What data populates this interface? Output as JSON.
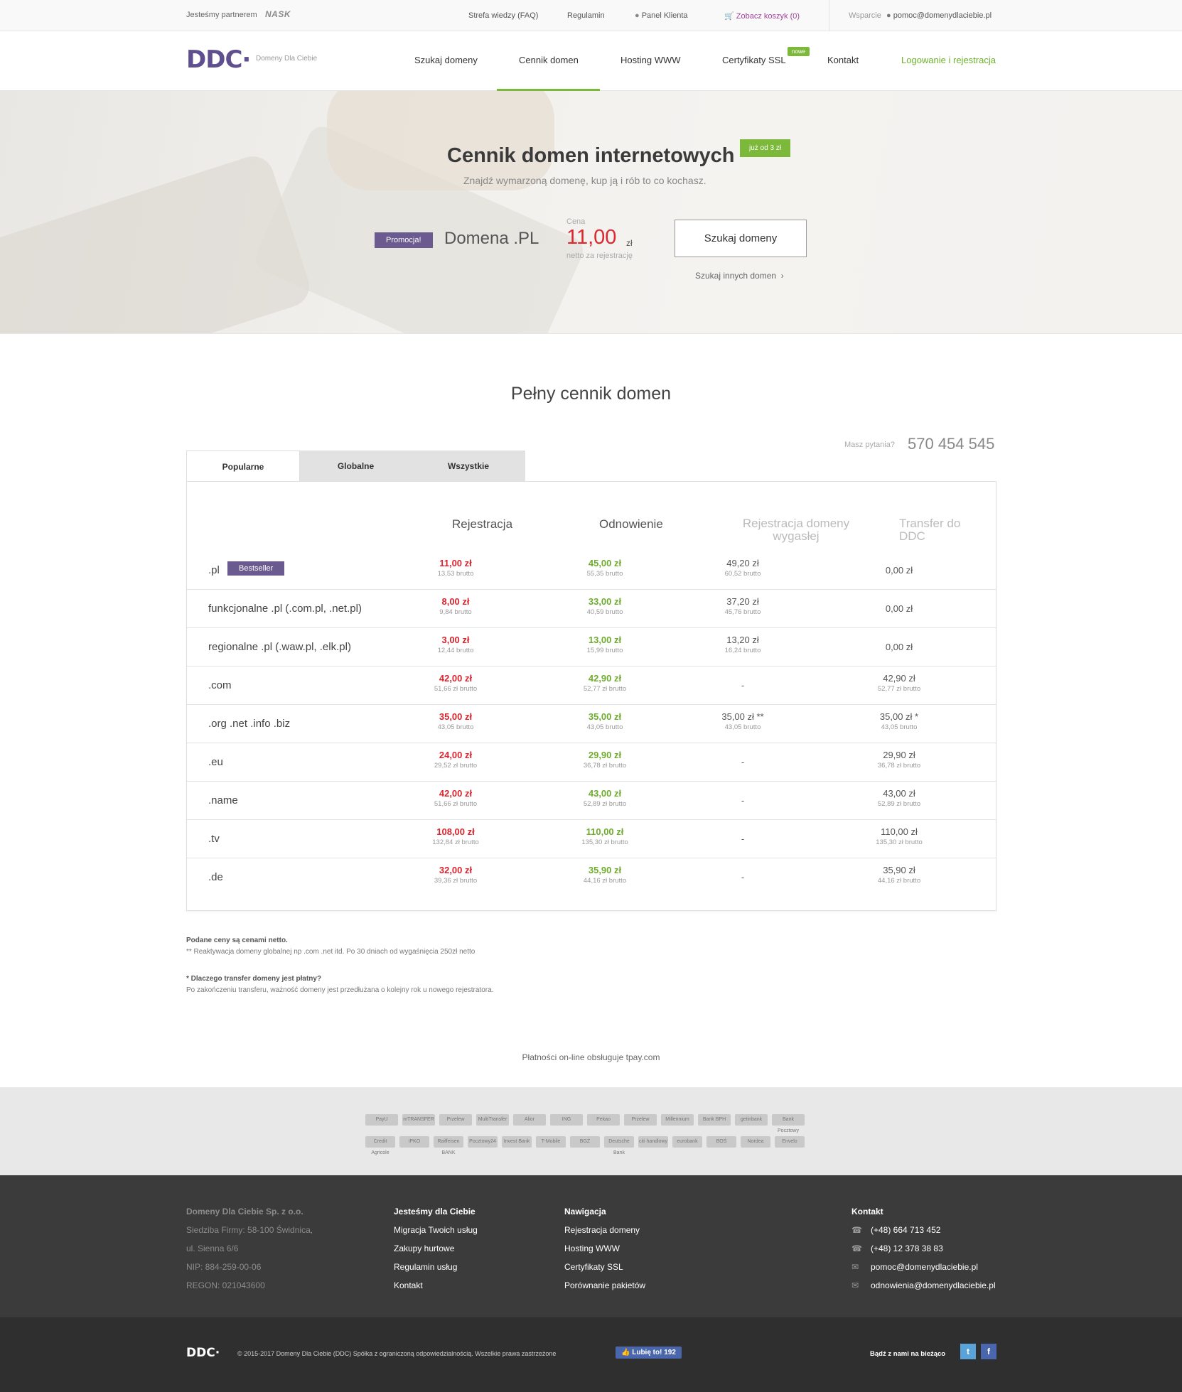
{
  "topbar": {
    "partner_label": "Jesteśmy partnerem",
    "partner_logo": "NASK",
    "faq": "Strefa wiedzy (FAQ)",
    "terms": "Regulamin",
    "panel": "Panel Klienta",
    "cart": "Zobacz koszyk (0)",
    "support": "Wsparcie",
    "email": "pomoc@domenydlaciebie.pl"
  },
  "header": {
    "logo": "DDC·",
    "logo_sub": "Domeny Dla Ciebie",
    "nav": [
      "Szukaj domeny",
      "Cennik domen",
      "Hosting WWW",
      "Certyfikaty SSL",
      "Kontakt"
    ],
    "new_badge": "nowe",
    "login": "Logowanie i rejestracja"
  },
  "hero": {
    "title": "Cennik domen internetowych",
    "from_badge": "już od 3 zł",
    "subtitle": "Znajdź wymarzoną domenę, kup ją i rób to co kochasz.",
    "promo_badge": "Promocja!",
    "domain": "Domena .PL",
    "price_label": "Cena",
    "price": "11,00",
    "currency": "zł",
    "price_note": "netto za rejestrację",
    "search_button": "Szukaj domeny",
    "other_link": "Szukaj innych domen"
  },
  "pricing": {
    "title": "Pełny cennik domen",
    "question": "Masz pytania?",
    "phone": "570 454 545",
    "tabs": [
      "Popularne",
      "Globalne",
      "Wszystkie"
    ],
    "headers": [
      "Rejestracja",
      "Odnowienie",
      "Rejestracja domeny wygasłej",
      "Transfer do DDC"
    ],
    "bestseller": "Bestseller",
    "rows": [
      {
        "name": ".pl",
        "reg": "11,00 zł",
        "reg_b": "13,53 brutto",
        "ren": "45,00 zł",
        "ren_b": "55,35 brutto",
        "exp": "49,20 zł",
        "exp_b": "60,52 brutto",
        "tr": "0,00 zł",
        "tr_b": ""
      },
      {
        "name": "funkcjonalne .pl (.com.pl, .net.pl)",
        "reg": "8,00 zł",
        "reg_b": "9,84 brutto",
        "ren": "33,00 zł",
        "ren_b": "40,59 brutto",
        "exp": "37,20 zł",
        "exp_b": "45,76 brutto",
        "tr": "0,00 zł",
        "tr_b": ""
      },
      {
        "name": "regionalne .pl (.waw.pl, .elk.pl)",
        "reg": "3,00 zł",
        "reg_b": "12,44 brutto",
        "ren": "13,00 zł",
        "ren_b": "15,99 brutto",
        "exp": "13,20 zł",
        "exp_b": "16,24 brutto",
        "tr": "0,00 zł",
        "tr_b": ""
      },
      {
        "name": ".com",
        "reg": "42,00 zł",
        "reg_b": "51,66 zł brutto",
        "ren": "42,90 zł",
        "ren_b": "52,77 zł brutto",
        "exp": "-",
        "exp_b": "",
        "tr": "42,90 zł",
        "tr_b": "52,77 zł brutto"
      },
      {
        "name": ".org .net .info .biz",
        "reg": "35,00 zł",
        "reg_b": "43,05 brutto",
        "ren": "35,00 zł",
        "ren_b": "43,05 brutto",
        "exp": "35,00 zł **",
        "exp_b": "43,05 brutto",
        "tr": "35,00 zł *",
        "tr_b": "43,05 brutto"
      },
      {
        "name": ".eu",
        "reg": "24,00 zł",
        "reg_b": "29,52 zł brutto",
        "ren": "29,90 zł",
        "ren_b": "36,78 zł brutto",
        "exp": "-",
        "exp_b": "",
        "tr": "29,90 zł",
        "tr_b": "36,78 zł brutto"
      },
      {
        "name": ".name",
        "reg": "42,00 zł",
        "reg_b": "51,66 zł brutto",
        "ren": "43,00 zł",
        "ren_b": "52,89 zł brutto",
        "exp": "-",
        "exp_b": "",
        "tr": "43,00 zł",
        "tr_b": "52,89 zł brutto"
      },
      {
        "name": ".tv",
        "reg": "108,00 zł",
        "reg_b": "132,84 zł brutto",
        "ren": "110,00 zł",
        "ren_b": "135,30 zł brutto",
        "exp": "-",
        "exp_b": "",
        "tr": "110,00 zł",
        "tr_b": "135,30 zł brutto"
      },
      {
        "name": ".de",
        "reg": "32,00 zł",
        "reg_b": "39,36 zł brutto",
        "ren": "35,90 zł",
        "ren_b": "44,16 zł brutto",
        "exp": "-",
        "exp_b": "",
        "tr": "35,90 zł",
        "tr_b": "44,16 zł brutto"
      }
    ]
  },
  "notes": {
    "n1_title": "Podane ceny są cenami netto.",
    "n1_text": "** Reaktywacja domeny globalnej np .com .net itd. Po 30 dniach od wygaśnięcia 250zł netto",
    "n2_title": "* Dlaczego transfer domeny jest płatny?",
    "n2_text": "Po zakończeniu transferu, ważność domeny jest przedłużana o kolejny rok u nowego rejestratora."
  },
  "tpay": "Płatności on-line obsługuje tpay.com",
  "banks": {
    "row1": [
      "PayU",
      "mTRANSFER",
      "Przelew",
      "MultiTransfer",
      "Alior",
      "ING",
      "Pekao",
      "Przelew",
      "Millennium",
      "Bank BPH",
      "getinbank",
      "Bank Pocztowy"
    ],
    "row2": [
      "Credit Agricole",
      "iPKO",
      "Raiffeisen BANK",
      "Pocztowy24",
      "Invest Bank",
      "T-Mobile",
      "BGŻ",
      "Deutsche Bank",
      "citi handlowy",
      "eurobank",
      "BOŚ",
      "Nordea",
      "Envelo"
    ]
  },
  "footer": {
    "company": [
      "Domeny Dla Ciebie Sp. z o.o.",
      "Siedziba Firmy: 58-100 Świdnica,",
      "ul. Sienna 6/6",
      "NIP: 884-259-00-06",
      "REGON: 021043600"
    ],
    "col1_title": "Jesteśmy dla Ciebie",
    "col1": [
      "Migracja Twoich usług",
      "Zakupy hurtowe",
      "Regulamin usług",
      "Kontakt"
    ],
    "col2_title": "Nawigacja",
    "col2": [
      "Rejestracja domeny",
      "Hosting WWW",
      "Certyfikaty SSL",
      "Porównanie pakietów"
    ],
    "contact_title": "Kontakt",
    "contact": [
      "(+48) 664 713 452",
      "(+48) 12 378 38 83",
      "pomoc@domenydlaciebie.pl",
      "odnowienia@domenydlaciebie.pl"
    ]
  },
  "bottom": {
    "logo": "DDC·",
    "copyright": "© 2015-2017 Domeny Dla Ciebie (DDC) Spółka z ograniczoną odpowiedzialnością. Wszelkie prawa zastrzeżone",
    "like": "Lubię to! 192",
    "follow": "Bądź z nami na bieżąco",
    "twitter_glyph": "t",
    "facebook_glyph": "f"
  },
  "colors": {
    "brand": "#5f4f8e",
    "accent": "#7cb93b",
    "price": "#d9242e",
    "renew": "#6eab2e"
  }
}
